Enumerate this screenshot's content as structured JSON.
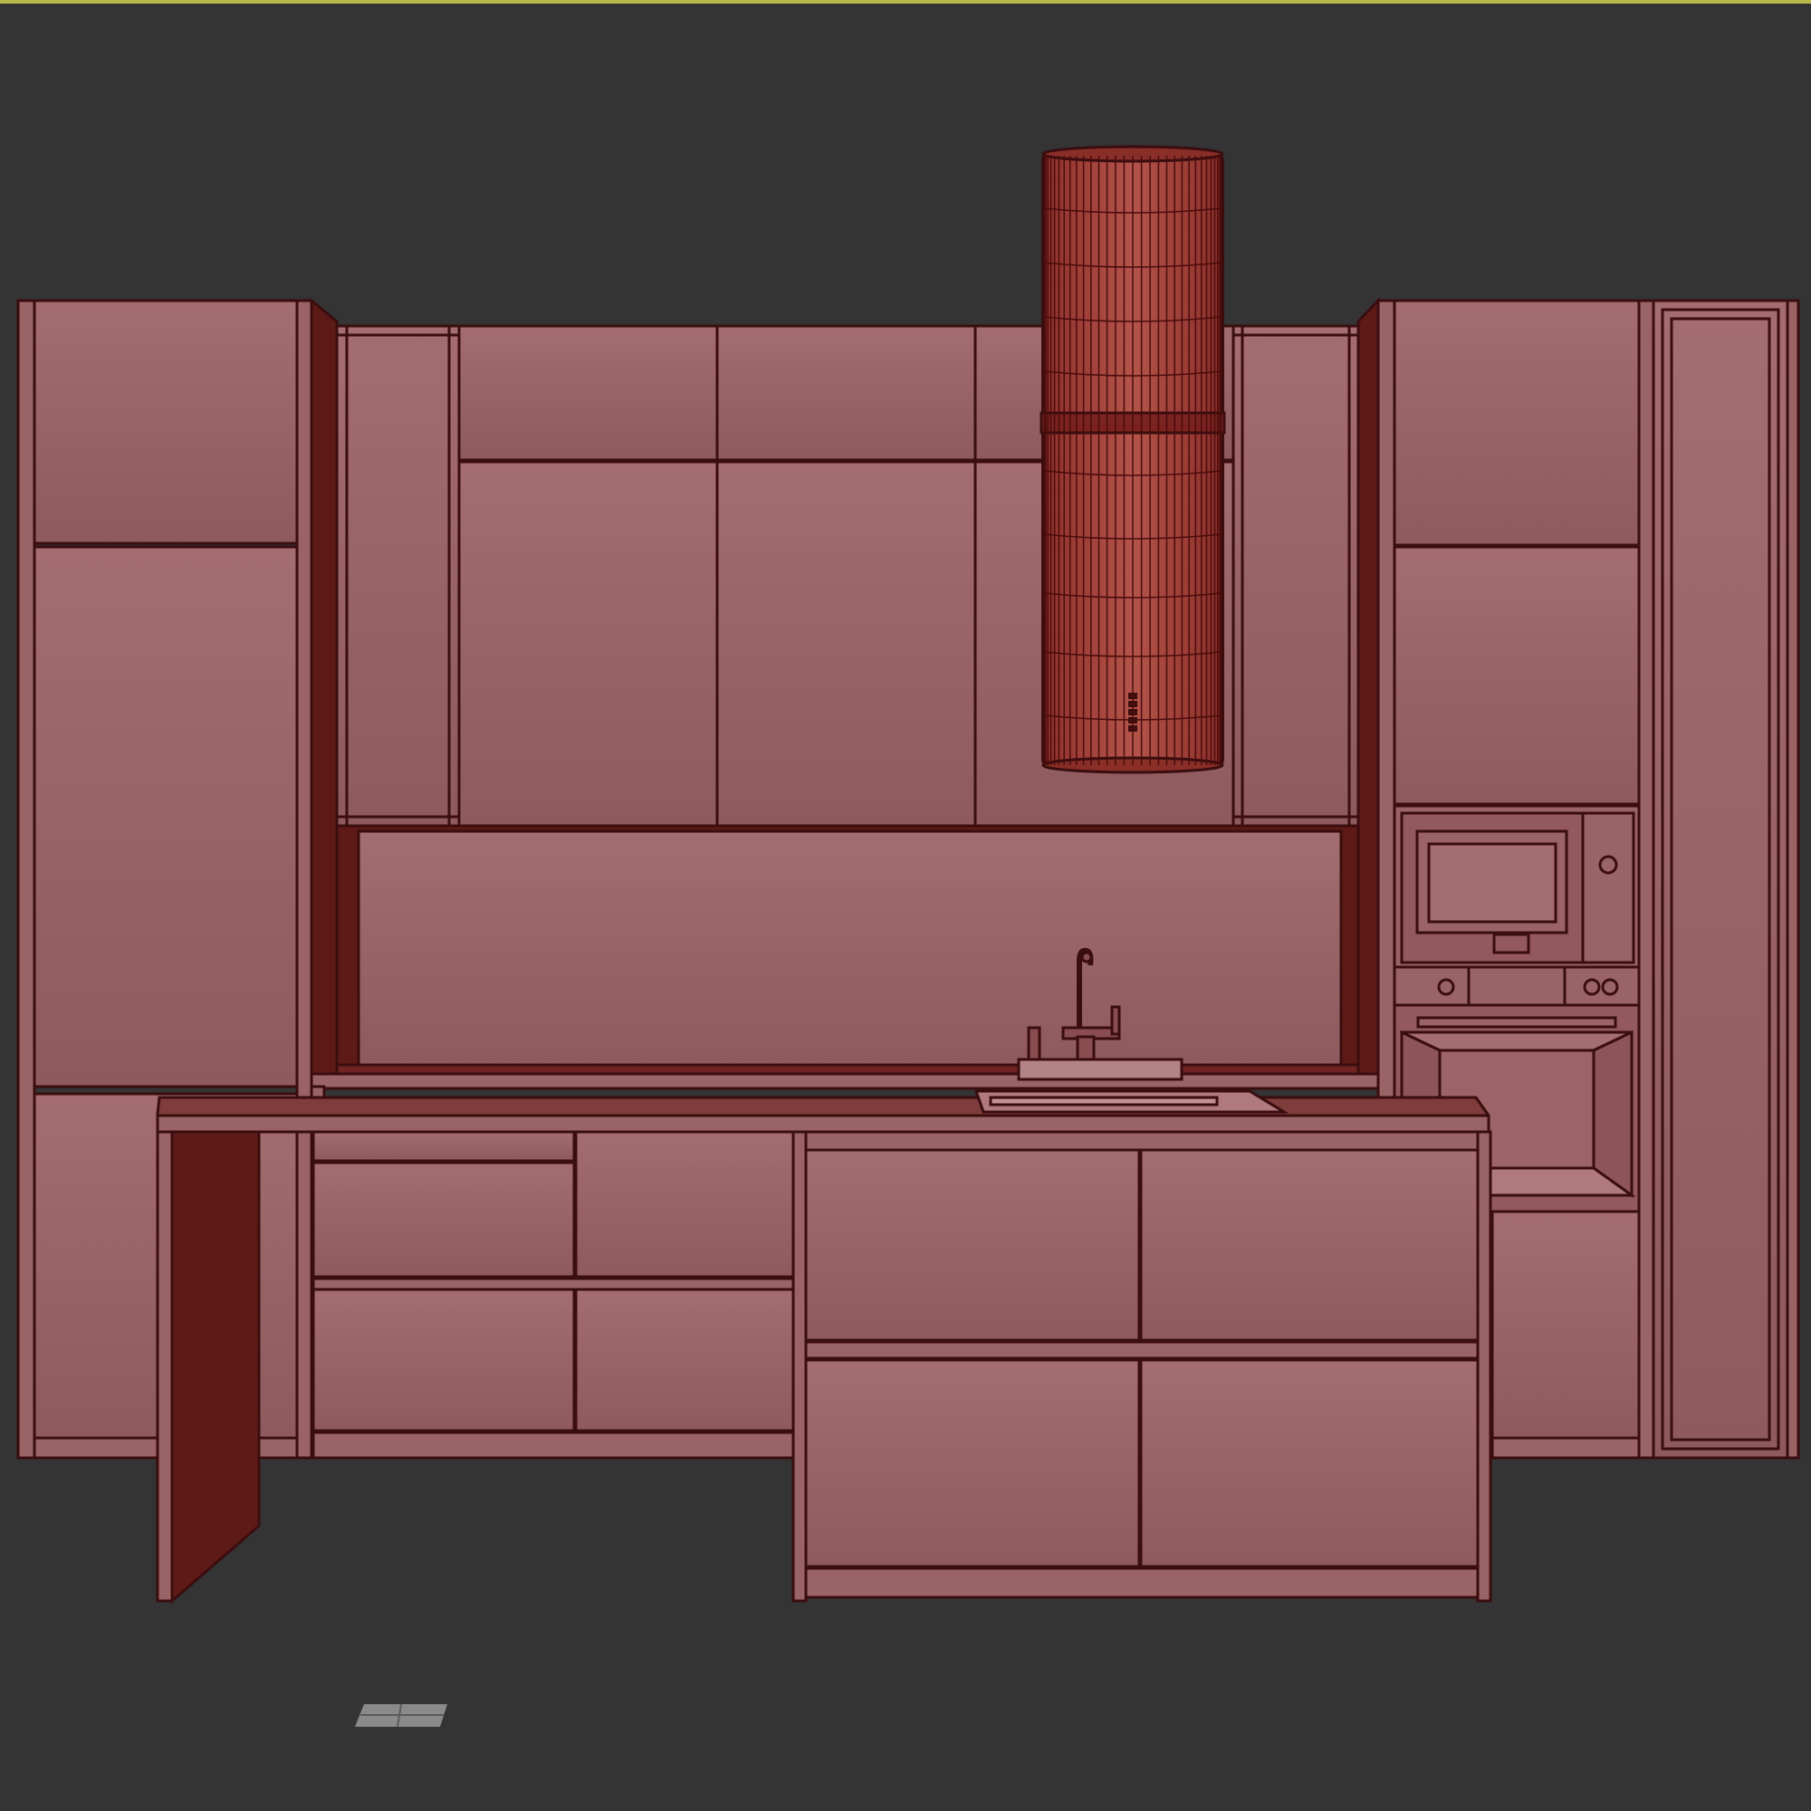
{
  "viewport": {
    "background": "#343434",
    "active_border_color": "#b7b74a"
  },
  "scene": {
    "object": "kitchen-model-wireframe-on-shaded",
    "colors": {
      "panel": "#9a6466",
      "panel_light": "#a0696b",
      "panel_dark": "#8f5a5d",
      "edge": "#3a0d0f",
      "shadow": "#5e1a16",
      "hood": "#b04a40",
      "hood_wire": "#4a0c0c",
      "gizmo": "#8a8a8a"
    }
  }
}
